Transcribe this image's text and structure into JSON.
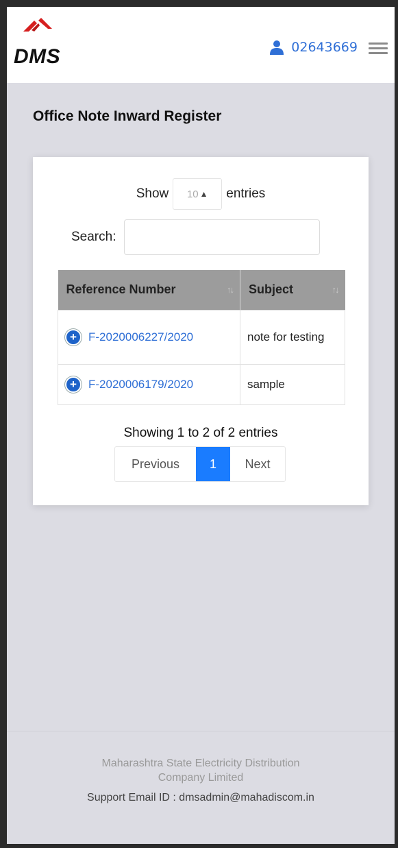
{
  "header": {
    "logo_text": "DMS",
    "user_id": "02643669",
    "colors": {
      "logo_red": "#d62020",
      "link_blue": "#2f6fd6"
    }
  },
  "page": {
    "title": "Office Note Inward Register"
  },
  "table_controls": {
    "show_label": "Show",
    "entries_value": "10",
    "entries_label": "entries",
    "search_label": "Search:",
    "search_value": ""
  },
  "table": {
    "columns": [
      "Reference Number",
      "Subject"
    ],
    "rows": [
      {
        "reference": "F-2020006227/2020",
        "subject": "note for testing"
      },
      {
        "reference": "F-2020006179/2020",
        "subject": "sample"
      }
    ]
  },
  "pagination": {
    "info": "Showing 1 to 2 of 2 entries",
    "previous": "Previous",
    "current": "1",
    "next": "Next",
    "active_color": "#1a7cff"
  },
  "footer": {
    "org_line1": "Maharashtra State Electricity Distribution",
    "org_line2": "Company Limited",
    "support": "Support Email ID :  dmsadmin@mahadiscom.in"
  }
}
